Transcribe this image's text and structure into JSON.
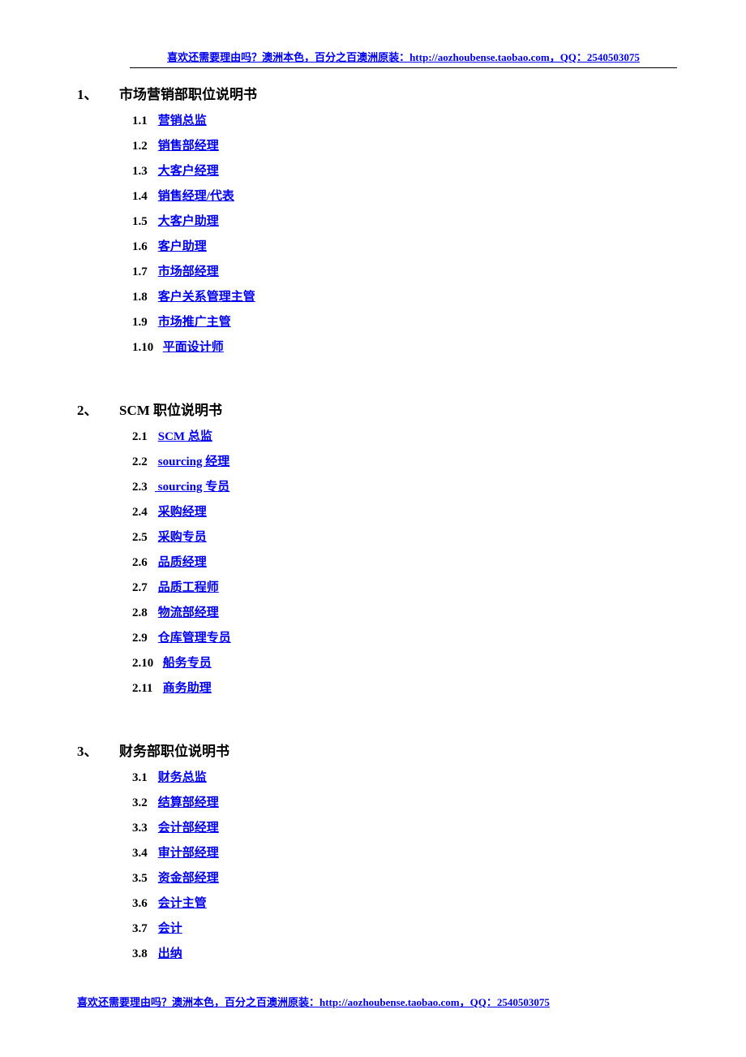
{
  "header": "喜欢还需要理由吗？澳洲本色，百分之百澳洲原装：http://aozhoubense.taobao.com，QQ：2540503075",
  "footer": "喜欢还需要理由吗？澳洲本色，百分之百澳洲原装：http://aozhoubense.taobao.com，QQ：2540503075",
  "sections": [
    {
      "num": "1、",
      "title": "市场营销部职位说明书",
      "items": [
        {
          "num": "1.1",
          "label": "营销总监"
        },
        {
          "num": "1.2",
          "label": "销售部经理"
        },
        {
          "num": "1.3",
          "label": "大客户经理"
        },
        {
          "num": "1.4",
          "label": "销售经理/代表"
        },
        {
          "num": "1.5",
          "label": "大客户助理"
        },
        {
          "num": "1.6",
          "label": "客户助理"
        },
        {
          "num": "1.7",
          "label": "市场部经理"
        },
        {
          "num": "1.8",
          "label": "客户关系管理主管"
        },
        {
          "num": "1.9",
          "label": "市场推广主管"
        },
        {
          "num": "1.10",
          "label": "平面设计师"
        }
      ]
    },
    {
      "num": "2、",
      "title": "SCM 职位说明书",
      "items": [
        {
          "num": "2.1",
          "label": "SCM 总监"
        },
        {
          "num": "2.2",
          "label": "sourcing 经理"
        },
        {
          "num": "2.3",
          "label": " sourcing 专员"
        },
        {
          "num": "2.4",
          "label": "采购经理"
        },
        {
          "num": "2.5",
          "label": "采购专员"
        },
        {
          "num": "2.6",
          "label": "品质经理"
        },
        {
          "num": "2.7",
          "label": "品质工程师"
        },
        {
          "num": "2.8",
          "label": "物流部经理"
        },
        {
          "num": "2.9",
          "label": "仓库管理专员"
        },
        {
          "num": "2.10",
          "label": "船务专员"
        },
        {
          "num": "2.11",
          "label": "商务助理"
        }
      ]
    },
    {
      "num": "3、",
      "title": "财务部职位说明书",
      "items": [
        {
          "num": "3.1",
          "label": "财务总监"
        },
        {
          "num": "3.2",
          "label": "结算部经理"
        },
        {
          "num": "3.3",
          "label": "会计部经理"
        },
        {
          "num": "3.4",
          "label": "审计部经理"
        },
        {
          "num": "3.5",
          "label": "资金部经理"
        },
        {
          "num": "3.6",
          "label": "会计主管"
        },
        {
          "num": "3.7",
          "label": "会计"
        },
        {
          "num": "3.8",
          "label": "出纳"
        }
      ]
    }
  ]
}
